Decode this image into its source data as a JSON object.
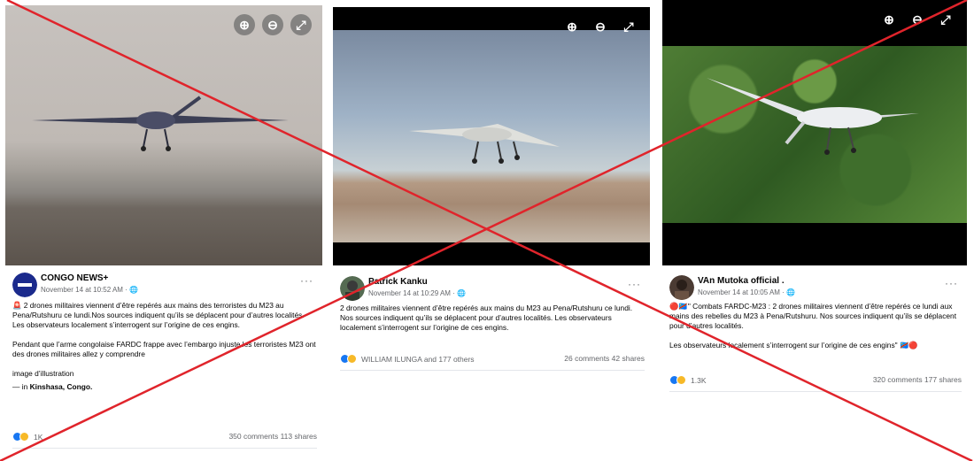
{
  "posts": [
    {
      "author": "CONGO NEWS+",
      "meta": "November 14 at 10:52 AM · 🌐",
      "more": "···",
      "body": [
        "🚨 2 drones militaires viennent d’être repérés aux mains des terroristes du M23 au Pena/Rutshuru ce lundi.Nos sources indiquent qu’ils se déplacent pour d’autres localités. Les observateurs localement s’interrogent sur l’origine de ces engins.",
        "Pendant que l’arme congolaise FARDC frappe avec l’embargo injuste les terroristes M23 ont des drones militaires allez y comprendre",
        "image d’illustration"
      ],
      "location_prefix": "— in ",
      "location": "Kinshasa, Congo.",
      "reaction_count": "1K",
      "engagement": "350 comments  113 shares"
    },
    {
      "author": "Patrick Kanku",
      "meta": "November 14 at 10:29 AM · 🌐",
      "more": "···",
      "body": [
        "2 drones militaires viennent d’être repérés aux mains du M23 au Pena/Rutshuru ce lundi. Nos sources indiquent qu’ils se déplacent pour d’autres localités. Les observateurs localement s’interrogent sur l’origine de ces engins."
      ],
      "reaction_count": "WILLIAM ILUNGA and 177 others",
      "engagement": "26 comments  42 shares"
    },
    {
      "author": "VAn Mutoka official .",
      "meta": "November 14 at 10:05 AM · 🌐",
      "more": "···",
      "body": [
        "🔴🇨🇩\" Combats FARDC-M23 : 2 drones militaires viennent d’être repérés ce lundi aux mains des rebelles du M23 à Pena/Rutshuru. Nos sources indiquent qu’ils se déplacent pour d’autres localités.",
        "Les observateurs localement s’interrogent sur l’origine de ces engins\" 🇨🇩🔴"
      ],
      "reaction_count": "1.3K",
      "engagement": "320 comments  177 shares"
    }
  ],
  "zoom": {
    "in": "⊕",
    "out": "⊖",
    "expand": "⤢"
  },
  "icons": {
    "more": "more-options-icon",
    "zoom_in": "zoom-in-icon",
    "zoom_out": "zoom-out-icon",
    "fullscreen": "fullscreen-icon"
  },
  "colors": {
    "cross": "#e0242b",
    "like": "#1877f2",
    "care": "#f7b928",
    "meta": "#65676b"
  }
}
